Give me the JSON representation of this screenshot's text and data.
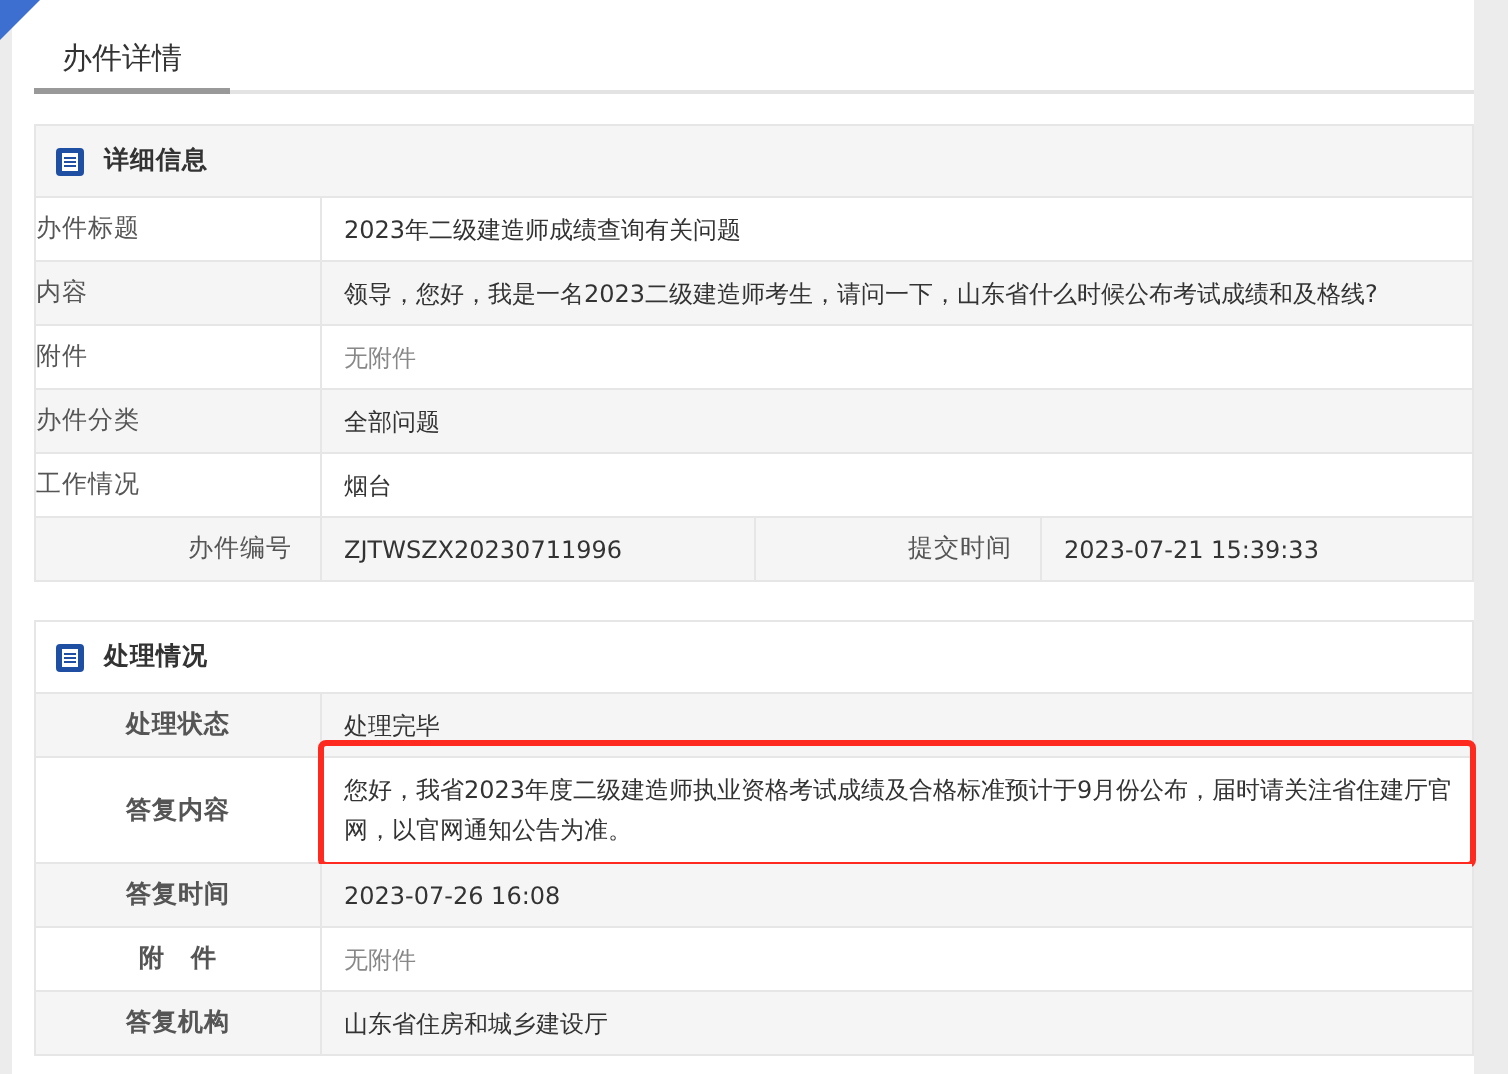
{
  "page_title": "办件详情",
  "details": {
    "title": "详细信息",
    "rows": [
      {
        "label": "办件标题",
        "value": "2023年二级建造师成绩查询有关问题",
        "muted": false
      },
      {
        "label": "内容",
        "value": "领导，您好，我是一名2023二级建造师考生，请问一下，山东省什么时候公布考试成绩和及格线?",
        "muted": false
      },
      {
        "label": "附件",
        "value": "无附件",
        "muted": true
      },
      {
        "label": "办件分类",
        "value": "全部问题",
        "muted": false
      },
      {
        "label": "工作情况",
        "value": "烟台",
        "muted": false
      }
    ],
    "footer": [
      {
        "label": "办件编号",
        "value": "ZJTWSZX20230711996"
      },
      {
        "label": "提交时间",
        "value": "2023-07-21 15:39:33"
      }
    ]
  },
  "processing": {
    "title": "处理情况",
    "rows": [
      {
        "label": "处理状态",
        "value": "处理完毕",
        "muted": false,
        "highlighted": false
      },
      {
        "label": "答复内容",
        "value": "您好，我省2023年度二级建造师执业资格考试成绩及合格标准预计于9月份公布，届时请关注省住建厅官网，以官网通知公告为准。",
        "muted": false,
        "highlighted": true
      },
      {
        "label": "答复时间",
        "value": "2023-07-26 16:08",
        "muted": false,
        "highlighted": false
      },
      {
        "label": "附　件",
        "value": "无附件",
        "muted": true,
        "highlighted": false
      },
      {
        "label": "答复机构",
        "value": "山东省住房和城乡建设厅",
        "muted": false,
        "highlighted": false
      }
    ]
  }
}
